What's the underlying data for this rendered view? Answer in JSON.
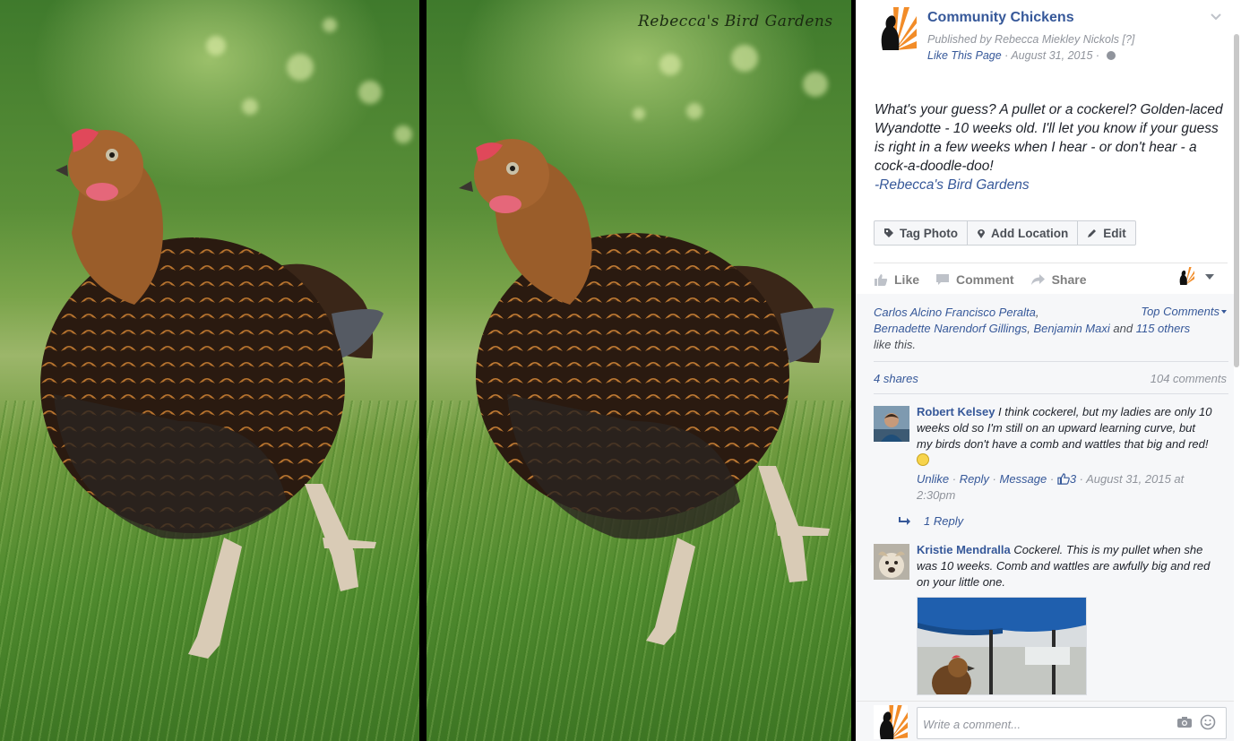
{
  "photo": {
    "watermark": "Rebecca's Bird Gardens"
  },
  "post": {
    "page_name": "Community Chickens",
    "published_by": "Published by Rebecca Miekley Nickols",
    "published_help": "[?]",
    "like_page": "Like This Page",
    "date": "August 31, 2015",
    "caption": "What's your guess? A pullet or a cockerel? Golden-laced Wyandotte - 10 weeks old. I'll let you know if your guess is right in a few weeks when I hear - or don't hear - a cock-a-doodle-doo!",
    "caption_signature": "-Rebecca's Bird Gardens",
    "photo_actions": {
      "tag": "Tag Photo",
      "location": "Add Location",
      "edit": "Edit"
    },
    "actions": {
      "like": "Like",
      "comment": "Comment",
      "share": "Share"
    }
  },
  "ufi": {
    "liker_1": "Carlos Alcino Francisco Peralta",
    "liker_2": "Bernadette Narendorf Gillings",
    "liker_3": "Benjamin Maxi",
    "likers_and": "and",
    "likers_others": "115 others",
    "likers_suffix": "like this.",
    "top_comments": "Top Comments",
    "shares": "4 shares",
    "comments_count": "104 comments"
  },
  "comments": [
    {
      "author": "Robert Kelsey",
      "text": "I think cockerel, but my ladies are only 10 weeks old so I'm still on an upward learning curve, but my birds don't have a comb and wattles that big and red!",
      "unlike": "Unlike",
      "reply": "Reply",
      "message": "Message",
      "likes": "3",
      "timestamp": "August 31, 2015 at 2:30pm",
      "replies": "1 Reply"
    },
    {
      "author": "Kristie Mendralla",
      "text": "Cockerel. This is my pullet when she was 10 weeks. Comb and wattles are awfully big and red on your little one."
    }
  ],
  "composer": {
    "placeholder": "Write a comment..."
  },
  "colors": {
    "link": "#365899",
    "meta": "#90949c",
    "text": "#1d2129",
    "logo_orange": "#f28c28"
  }
}
